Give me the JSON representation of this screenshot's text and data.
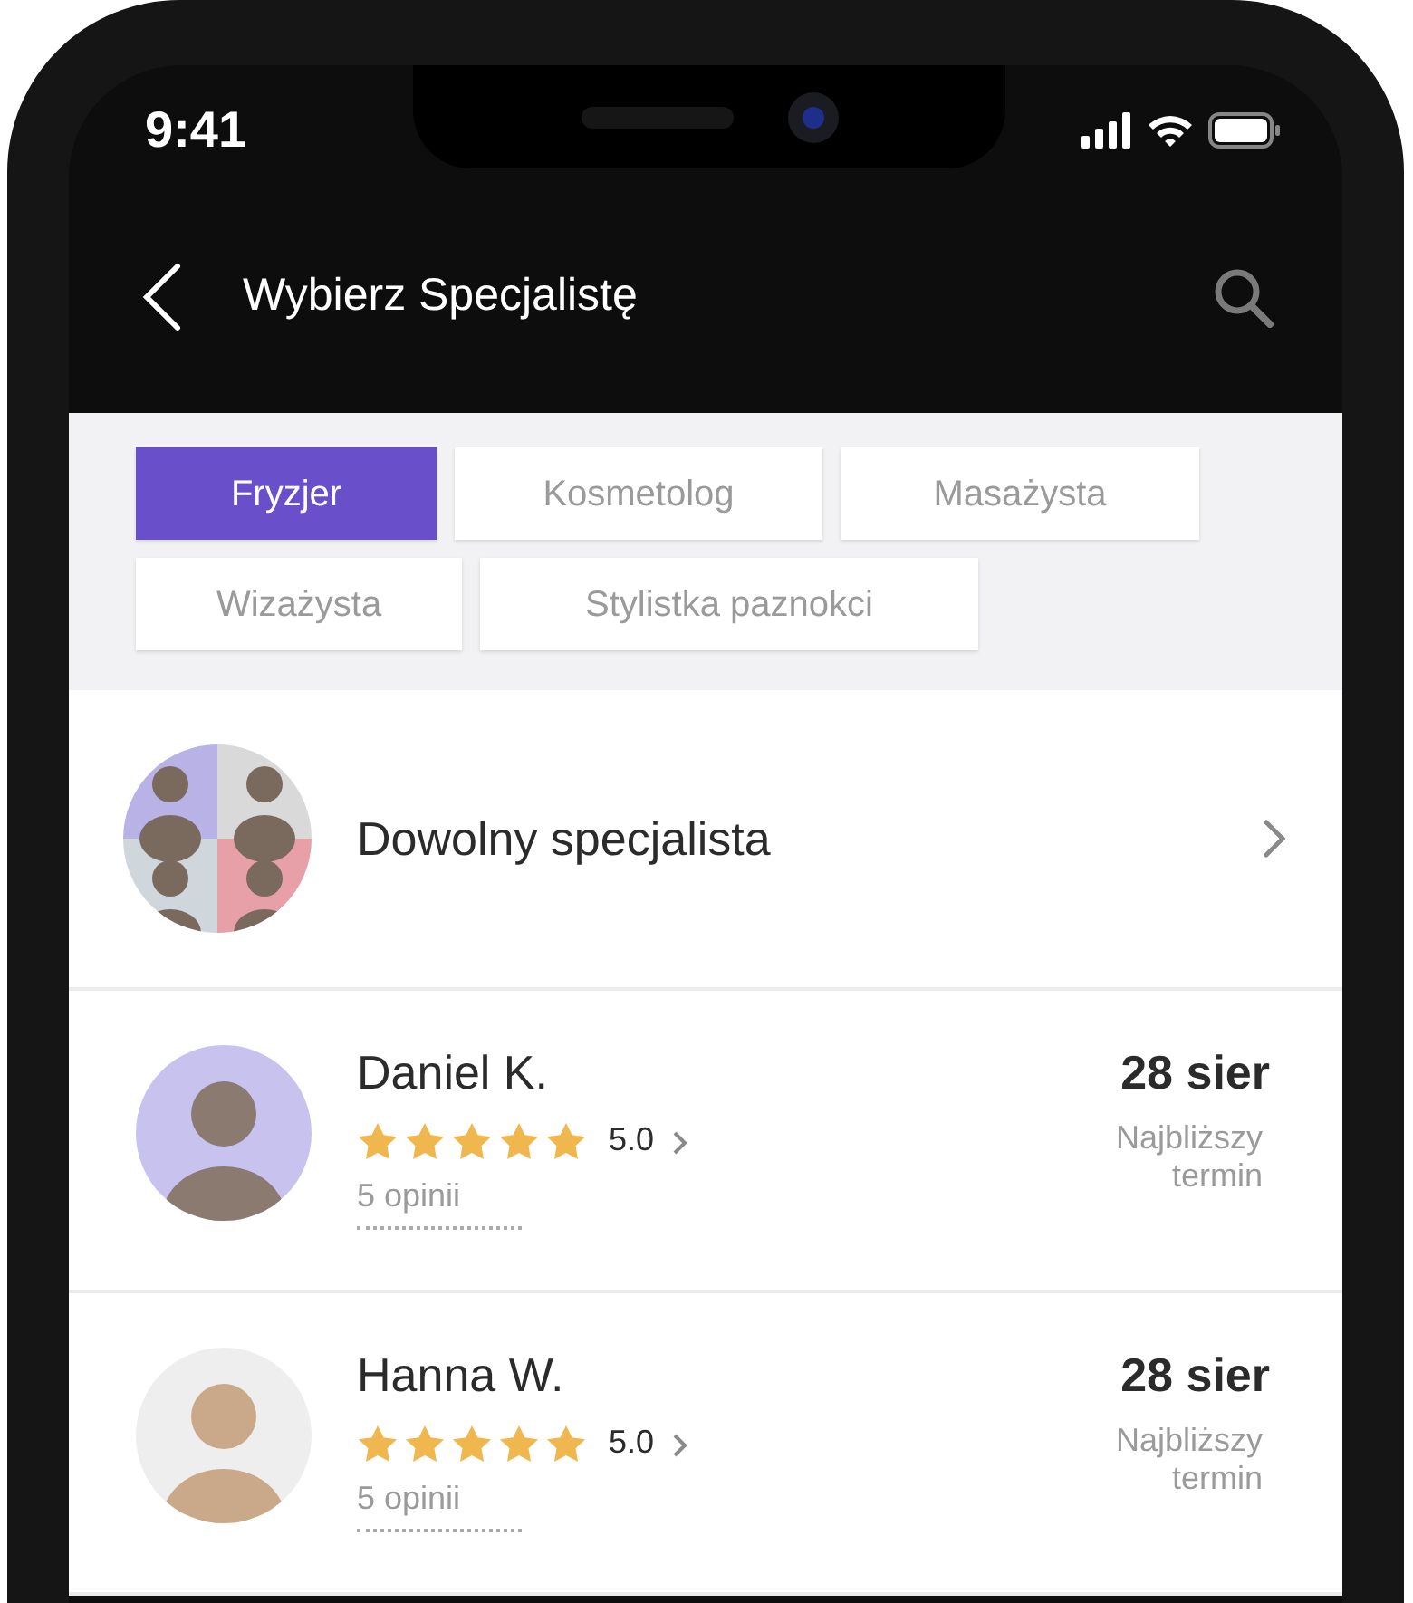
{
  "status_bar": {
    "time": "9:41"
  },
  "header": {
    "title": "Wybierz Specjalistę"
  },
  "categories": [
    {
      "label": "Fryzjer",
      "selected": true
    },
    {
      "label": "Kosmetolog",
      "selected": false
    },
    {
      "label": "Masażysta",
      "selected": false
    },
    {
      "label": "Wizażysta",
      "selected": false
    },
    {
      "label": "Stylistka paznokci",
      "selected": false
    }
  ],
  "any_specialist": {
    "label": "Dowolny specjalista"
  },
  "specialists": [
    {
      "name": "Daniel K.",
      "stars": 5,
      "rating": "5.0",
      "reviews": "5 opinii",
      "date": "28 sier",
      "date_label": "Najbliższy termin"
    },
    {
      "name": "Hanna W.",
      "stars": 5,
      "rating": "5.0",
      "reviews": "5 opinii",
      "date": "28 sier",
      "date_label": "Najbliższy termin"
    }
  ]
}
